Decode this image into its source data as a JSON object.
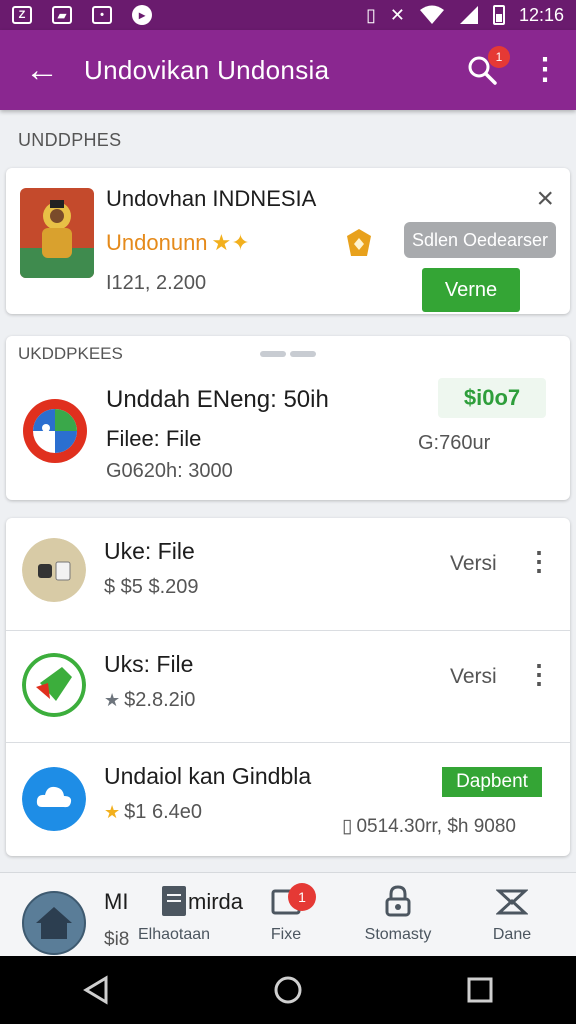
{
  "status_bar": {
    "icons": [
      "notification-icon-1",
      "image-icon",
      "message-icon",
      "play-icon"
    ],
    "time": "12:16"
  },
  "app_bar": {
    "title": "Undovikan Undonsia",
    "notification_count": "1"
  },
  "section1": {
    "label": "UNDDPHES"
  },
  "featured_app": {
    "name": "Undovhan INDNESIA",
    "developer": "Undonunn",
    "size": "I121, 2.200",
    "button_secondary": "Sdlen Oedearser",
    "button_primary": "Verne"
  },
  "section2": {
    "label": "UKDDPKEES",
    "app": {
      "title": "Unddah ENeng: 50ih",
      "subtitle": "Filee: File",
      "meta": "G0620h: 3000",
      "price": "$i0o7",
      "size": "G:760ur"
    }
  },
  "list": [
    {
      "title": "Uke: File",
      "price": "$ $5 $.209",
      "version": "Versi"
    },
    {
      "title": "Uks: File",
      "price": "$2.8.2i0",
      "version": "Versi"
    },
    {
      "title": "Undaiol kan Gindbla",
      "price": "$1 6.4e0",
      "badge": "Dapbent",
      "size": "0514.30rr, $h 9080"
    }
  ],
  "bottom_nav": {
    "peek_title": "MI",
    "peek_subtitle": "$i8",
    "items": [
      {
        "label": "Elhaotaan",
        "peek_overlay": "mirda"
      },
      {
        "label": "Fixe",
        "badge": "1"
      },
      {
        "label": "Stomasty"
      },
      {
        "label": "Dane"
      }
    ]
  },
  "colors": {
    "app_bar": "#8a2790",
    "status_bar": "#6a1b6e",
    "green": "#34a535",
    "badge_red": "#e53935",
    "developer_orange": "#e58a1b"
  }
}
